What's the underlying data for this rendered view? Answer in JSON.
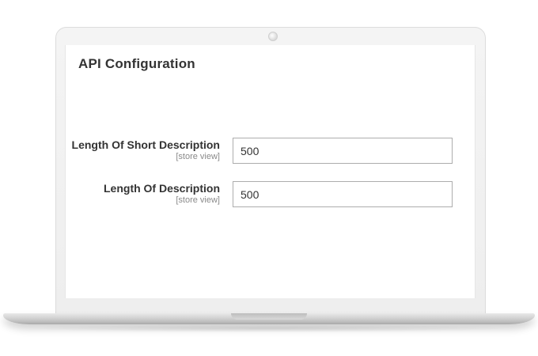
{
  "page": {
    "title": "API Configuration"
  },
  "fields": [
    {
      "label": "Length Of Short Description",
      "scope": "[store view]",
      "value": "500"
    },
    {
      "label": "Length Of Description",
      "scope": "[store view]",
      "value": "500"
    }
  ]
}
